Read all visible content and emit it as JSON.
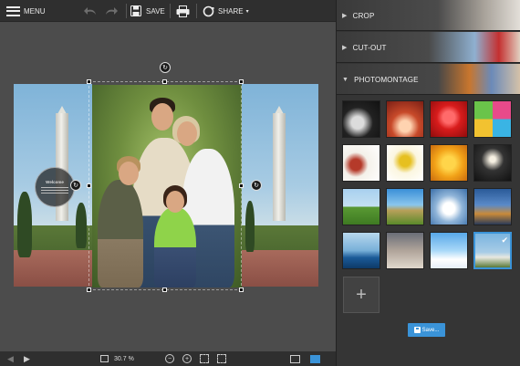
{
  "toolbar": {
    "menu_label": "MENU",
    "save_label": "SAVE",
    "share_label": "SHARE",
    "undo_icon": "undo-icon",
    "redo_icon": "redo-icon",
    "print_icon": "print-icon"
  },
  "canvas": {
    "welcome_title": "Welcome",
    "rotate_glyph": "↻"
  },
  "bottombar": {
    "zoom_value": "30.7 %",
    "zoom_out_glyph": "−",
    "zoom_in_glyph": "+"
  },
  "panel": {
    "sections": [
      {
        "label": "CROP",
        "arrow": "▶"
      },
      {
        "label": "CUT-OUT",
        "arrow": "▶"
      },
      {
        "label": "PHOTOMONTAGE",
        "arrow": "▼"
      }
    ],
    "add_glyph": "+",
    "save_button_label": "Save...",
    "selected_check": "✔"
  },
  "colors": {
    "accent": "#3a93d8",
    "toolbar_bg": "#2f2f2f",
    "panel_bg": "#353535",
    "canvas_bg": "#4c4c4c"
  }
}
